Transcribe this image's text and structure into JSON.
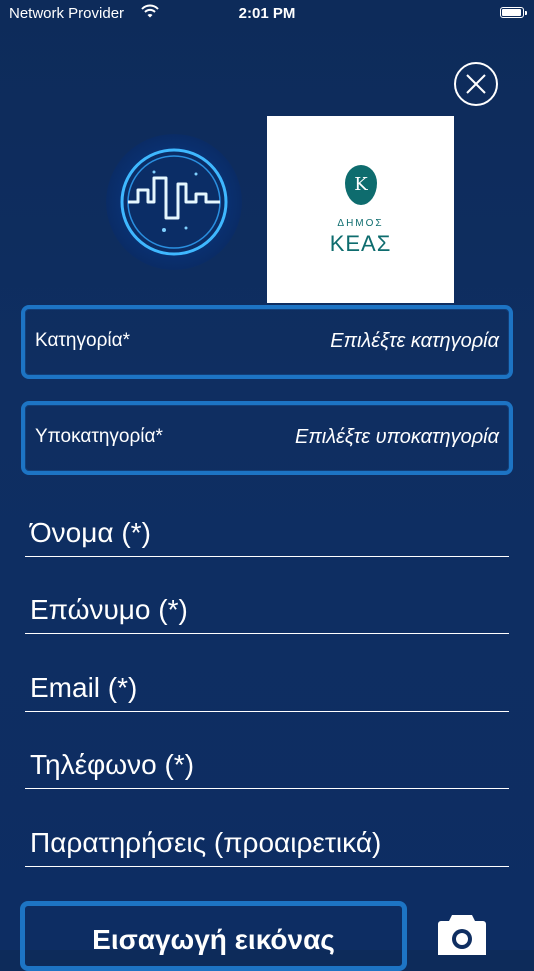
{
  "status_bar": {
    "carrier": "Network Provider",
    "time": "2:01 PM",
    "battery_level": 1.0
  },
  "logos": {
    "municipality_emblem_letter": "Κ",
    "municipality_line1": "ΔΗΜΟΣ",
    "municipality_line2": "ΚΕΑΣ"
  },
  "form": {
    "category": {
      "label": "Κατηγορία*",
      "value": "Επιλέξτε κατηγορία"
    },
    "subcategory": {
      "label": "Υποκατηγορία*",
      "value": "Επιλέξτε υποκατηγορία"
    },
    "fields": {
      "first_name": "Όνομα (*)",
      "last_name": "Επώνυμο (*)",
      "email": "Email (*)",
      "phone": "Τηλέφωνο (*)",
      "notes": "Παρατηρήσεις (προαιρετικά)"
    },
    "insert_image_label": "Εισαγωγή εικόνας"
  },
  "icons": {
    "close": "close-icon",
    "camera": "camera-icon",
    "wifi": "wifi-icon",
    "battery": "battery-icon"
  },
  "colors": {
    "background": "#0f2e61",
    "accent_border": "#1d74c4",
    "text": "#ffffff",
    "municipality_teal": "#0e6c6e"
  }
}
